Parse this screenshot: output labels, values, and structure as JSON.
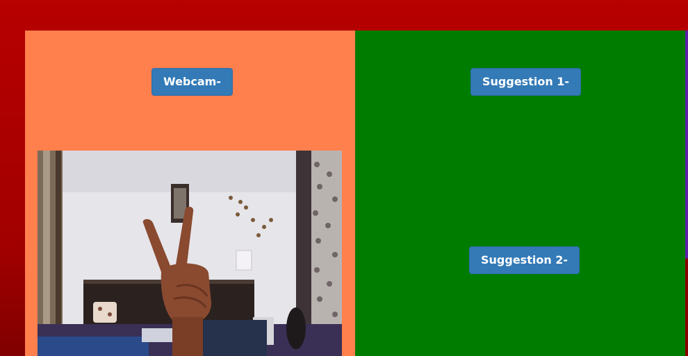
{
  "left_panel": {
    "button_label": "Webcam-",
    "color": "#ff7f4d"
  },
  "right_panel": {
    "suggestion_1_label": "Suggestion 1-",
    "suggestion_2_label": "Suggestion 2-",
    "color": "#007d00"
  },
  "colors": {
    "page_background": "#b70000",
    "button": "#337ab7",
    "button_text": "#ffffff"
  },
  "webcam_feed": {
    "content": "webcam video frame showing a hand making a V sign"
  }
}
